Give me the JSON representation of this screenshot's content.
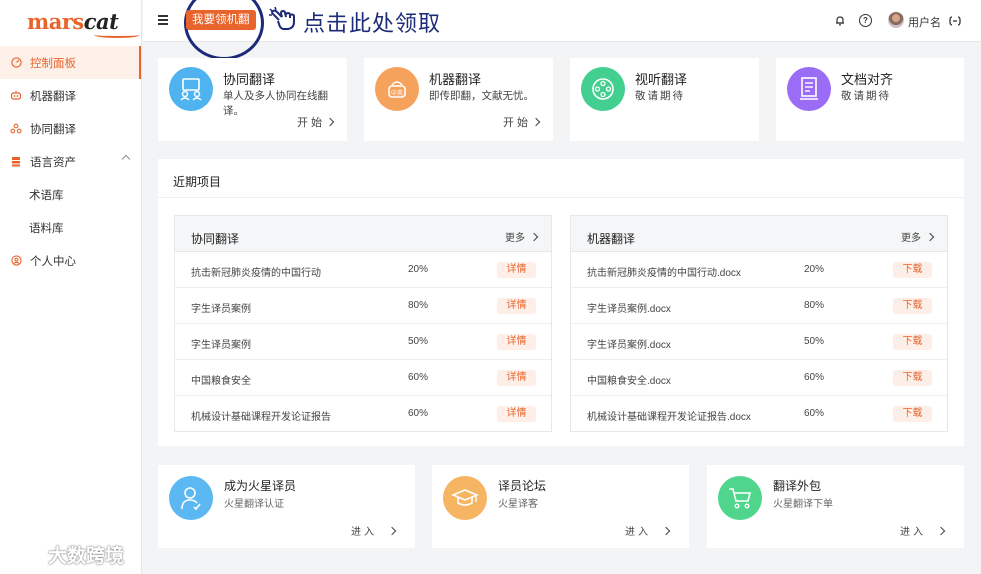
{
  "brand": {
    "logo_part1": "mars",
    "logo_part2": "cat",
    "accent": "#e8642c"
  },
  "sidebar": {
    "items": [
      {
        "label": "控制面板",
        "icon": "dashboard-icon"
      },
      {
        "label": "机器翻译",
        "icon": "robot-icon"
      },
      {
        "label": "协同翻译",
        "icon": "team-icon"
      },
      {
        "label": "语言资产",
        "icon": "database-icon"
      },
      {
        "label": "术语库"
      },
      {
        "label": "语料库"
      },
      {
        "label": "个人中心",
        "icon": "user-icon"
      }
    ]
  },
  "header": {
    "promo_button": "我要领机翻",
    "promo_text": "点击此处领取",
    "username": "用户名"
  },
  "top_cards": [
    {
      "title": "协同翻译",
      "desc": "单人及多人协同在线翻译。",
      "link": "开始",
      "icon": "collab-icon",
      "color": "#4fb3f0"
    },
    {
      "title": "机器翻译",
      "desc": "即传即翻，文献无忧。",
      "link": "开始",
      "icon": "machine-translate-icon",
      "color": "#f5a25d"
    },
    {
      "title": "视听翻译",
      "desc": "敬请期待",
      "icon": "film-reel-icon",
      "color": "#43cf8f"
    },
    {
      "title": "文档对齐",
      "desc": "敬请期待",
      "icon": "document-icon",
      "color": "#9b6cf5"
    }
  ],
  "recent": {
    "title": "近期项目",
    "tables": [
      {
        "title": "协同翻译",
        "more": "更多",
        "rows": [
          {
            "name": "抗击新冠肺炎疫情的中国行动",
            "pct": "20%",
            "action": "详情"
          },
          {
            "name": "字生译员案例",
            "pct": "80%",
            "action": "详情"
          },
          {
            "name": "字生译员案例",
            "pct": "50%",
            "action": "详情"
          },
          {
            "name": "中国粮食安全",
            "pct": "60%",
            "action": "详情"
          },
          {
            "name": "机械设计基础课程开发论证报告",
            "pct": "60%",
            "action": "详情"
          }
        ]
      },
      {
        "title": "机器翻译",
        "more": "更多",
        "rows": [
          {
            "name": "抗击新冠肺炎疫情的中国行动.docx",
            "pct": "20%",
            "action": "下载"
          },
          {
            "name": "字生译员案例.docx",
            "pct": "80%",
            "action": "下载"
          },
          {
            "name": "字生译员案例.docx",
            "pct": "50%",
            "action": "下载"
          },
          {
            "name": "中国粮食安全.docx",
            "pct": "60%",
            "action": "下载"
          },
          {
            "name": "机械设计基础课程开发论证报告.docx",
            "pct": "60%",
            "action": "下载"
          }
        ]
      }
    ]
  },
  "bottom_cards": [
    {
      "title": "成为火星译员",
      "desc": "火星翻译认证",
      "link": "进入",
      "icon": "translator-icon",
      "color": "#5cb8f2"
    },
    {
      "title": "译员论坛",
      "desc": "火星译客",
      "link": "进入",
      "icon": "graduation-cap-icon",
      "color": "#f5b562"
    },
    {
      "title": "翻译外包",
      "desc": "火星翻译下单",
      "link": "进入",
      "icon": "cart-icon",
      "color": "#4fd68c"
    }
  ],
  "watermark": "大数跨境"
}
